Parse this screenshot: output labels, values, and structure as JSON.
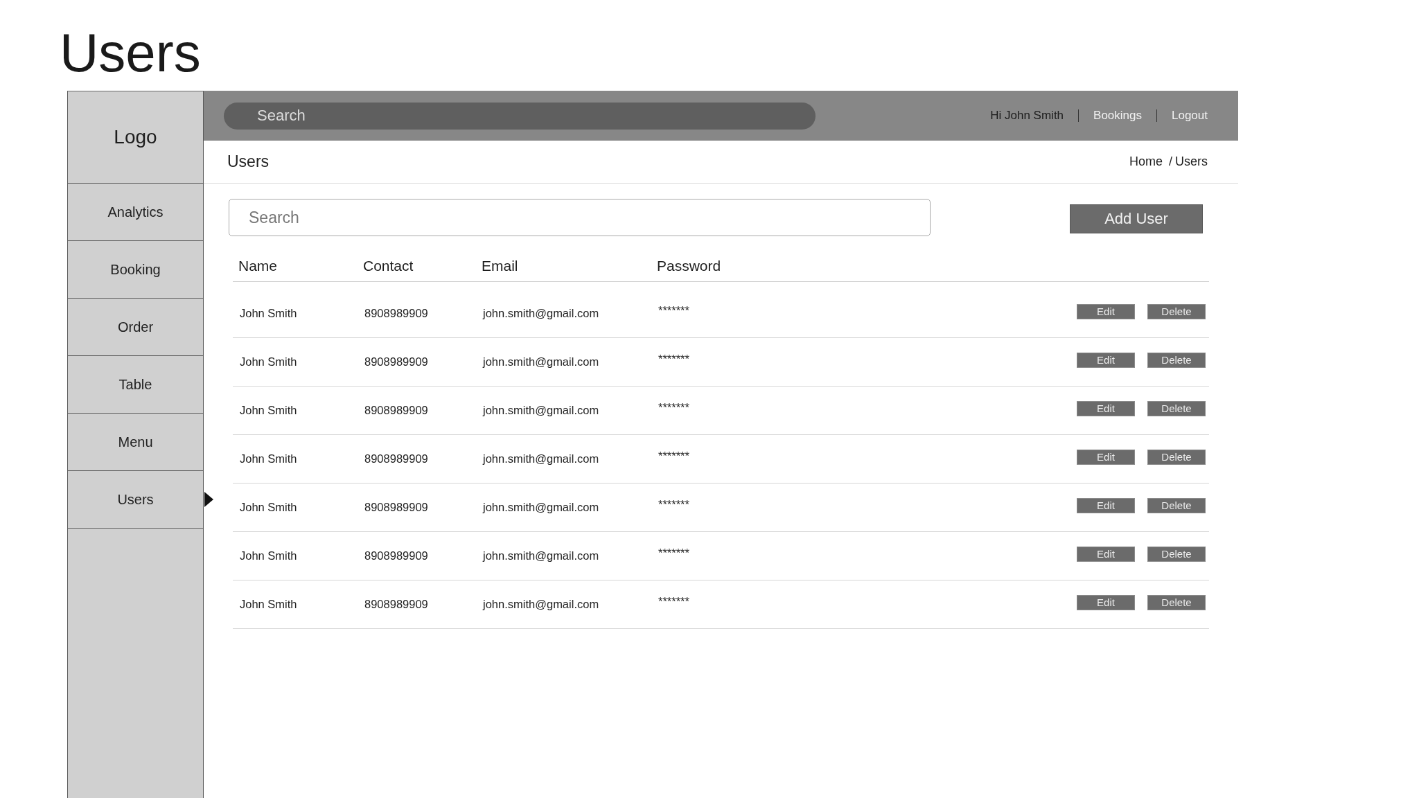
{
  "slide_title": "Users",
  "sidebar": {
    "logo": "Logo",
    "items": [
      {
        "label": "Analytics",
        "selected": false
      },
      {
        "label": "Booking",
        "selected": false
      },
      {
        "label": "Order",
        "selected": false
      },
      {
        "label": "Table",
        "selected": false
      },
      {
        "label": "Menu",
        "selected": false
      },
      {
        "label": "Users",
        "selected": true
      }
    ]
  },
  "top_bar": {
    "search": {
      "placeholder": "Search"
    },
    "greeting": "Hi John Smith",
    "links": [
      "Bookings",
      "Logout"
    ]
  },
  "page_header": {
    "title": "Users",
    "breadcrumb": {
      "items": [
        "Home",
        "Users"
      ],
      "separator": "/"
    }
  },
  "toolbar": {
    "search": {
      "placeholder": "Search"
    },
    "add_button": "Add User"
  },
  "table": {
    "columns": [
      "Name",
      "Contact",
      "Email",
      "Password"
    ],
    "rows": [
      {
        "name": "John Smith",
        "contact": "8908989909",
        "email": "john.smith@gmail.com",
        "password": "*******",
        "actions": [
          "Edit",
          "Delete"
        ]
      },
      {
        "name": "John Smith",
        "contact": "8908989909",
        "email": "john.smith@gmail.com",
        "password": "*******",
        "actions": [
          "Edit",
          "Delete"
        ]
      },
      {
        "name": "John Smith",
        "contact": "8908989909",
        "email": "john.smith@gmail.com",
        "password": "*******",
        "actions": [
          "Edit",
          "Delete"
        ]
      },
      {
        "name": "John Smith",
        "contact": "8908989909",
        "email": "john.smith@gmail.com",
        "password": "*******",
        "actions": [
          "Edit",
          "Delete"
        ]
      },
      {
        "name": "John Smith",
        "contact": "8908989909",
        "email": "john.smith@gmail.com",
        "password": "*******",
        "actions": [
          "Edit",
          "Delete"
        ]
      },
      {
        "name": "John Smith",
        "contact": "8908989909",
        "email": "john.smith@gmail.com",
        "password": "*******",
        "actions": [
          "Edit",
          "Delete"
        ]
      },
      {
        "name": "John Smith",
        "contact": "8908989909",
        "email": "john.smith@gmail.com",
        "password": "*******",
        "actions": [
          "Edit",
          "Delete"
        ]
      }
    ]
  }
}
